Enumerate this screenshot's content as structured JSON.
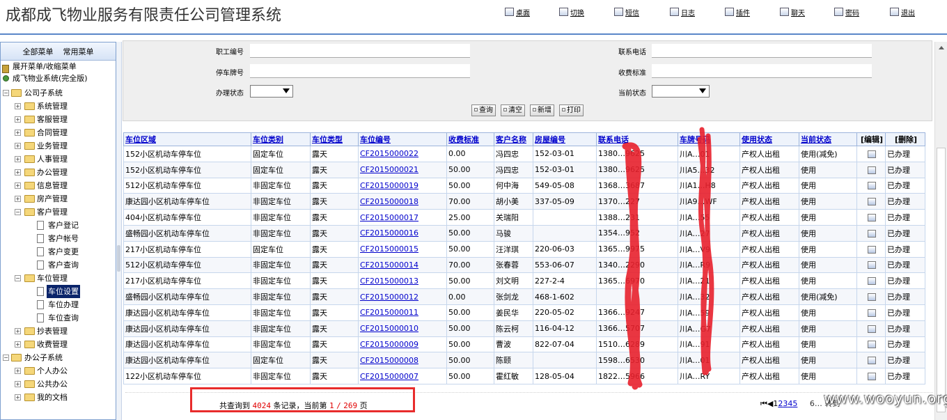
{
  "app": {
    "title": "成都成飞物业服务有限责任公司管理系统"
  },
  "toolbar": {
    "items": [
      {
        "label": "桌面",
        "icon": "desktop-icon"
      },
      {
        "label": "切换",
        "icon": "switch-icon"
      },
      {
        "label": "短信",
        "icon": "sms-icon"
      },
      {
        "label": "日志",
        "icon": "log-icon"
      },
      {
        "label": "插件",
        "icon": "plugin-icon"
      },
      {
        "label": "聊天",
        "icon": "chat-icon"
      },
      {
        "label": "密码",
        "icon": "password-icon"
      },
      {
        "label": "退出",
        "icon": "logout-icon"
      }
    ]
  },
  "sidebar": {
    "tabs": [
      "全部菜单",
      "常用菜单"
    ],
    "expand_label": "展开菜单/收缩菜单",
    "root_label": "成飞物业系统(完全版)",
    "company": "公司子系统",
    "modules": [
      "系统管理",
      "客服管理",
      "合同管理",
      "业务管理",
      "人事管理",
      "办公管理",
      "信息管理",
      "房产管理"
    ],
    "customer": {
      "label": "客户管理",
      "children": [
        "客户登记",
        "客户帐号",
        "客户变更",
        "客户查询"
      ]
    },
    "parking": {
      "label": "车位管理",
      "children": [
        "车位设置",
        "车位办理",
        "车位查询"
      ]
    },
    "after": [
      "抄表管理",
      "收费管理"
    ],
    "office": {
      "label": "办公子系统",
      "children": [
        "个人办公",
        "公共办公",
        "我的文档"
      ]
    }
  },
  "search": {
    "labels": {
      "employee_no": "职工编号",
      "phone": "联系电话",
      "plate": "停车牌号",
      "fee": "收费标准",
      "status": "办理状态",
      "current_status": "当前状态"
    },
    "values": {
      "employee_no": "",
      "phone": "",
      "plate": "",
      "fee": ""
    },
    "buttons": [
      "查询",
      "清空",
      "新增",
      "打印"
    ]
  },
  "table": {
    "headers": [
      "车位区域",
      "车位类别",
      "车位类型",
      "车位编号",
      "收费标准",
      "客户名称",
      "房屋编号",
      "联系电话",
      "车牌号码",
      "使用状态",
      "当前状态",
      "[编辑]",
      "[删除]"
    ],
    "rows": [
      [
        "152小区机动车停车位",
        "固定车位",
        "露天",
        "CF2015000022",
        "0.00",
        "冯四忠",
        "152-03-01",
        "1380…9625",
        "川A…01",
        "产权人出租",
        "使用(减免)",
        "已办理"
      ],
      [
        "152小区机动车停车位",
        "固定车位",
        "露天",
        "CF2015000021",
        "50.00",
        "冯四忠",
        "152-03-01",
        "1380…9625",
        "川A5…32",
        "产权人出租",
        "使用",
        "已办理"
      ],
      [
        "512小区机动车停车位",
        "非固定车位",
        "露天",
        "CF2015000019",
        "50.00",
        "何中海",
        "549-05-08",
        "1368…3687",
        "川A1…H8",
        "产权人出租",
        "使用",
        "已办理"
      ],
      [
        "康达园小区机动车停车位",
        "非固定车位",
        "露天",
        "CF2015000018",
        "70.00",
        "胡小美",
        "337-05-09",
        "1370…227",
        "川A9…WF",
        "产权人出租",
        "使用",
        "已办理"
      ],
      [
        "404小区机动车停车位",
        "非固定车位",
        "露天",
        "CF2015000017",
        "25.00",
        "关瑞阳",
        "",
        "1388…231",
        "川A…55",
        "产权人出租",
        "使用",
        "已办理"
      ],
      [
        "盛畅园小区机动车停车位",
        "非固定车位",
        "露天",
        "CF2015000016",
        "50.00",
        "马骏",
        "",
        "1354…952",
        "川A…27",
        "产权人出租",
        "使用",
        "已办理"
      ],
      [
        "217小区机动车停车位",
        "固定车位",
        "露天",
        "CF2015000015",
        "50.00",
        "汪洋琪",
        "220-06-03",
        "1365…9975",
        "川A…V9",
        "产权人出租",
        "使用",
        "已办理"
      ],
      [
        "512小区机动车停车位",
        "非固定车位",
        "露天",
        "CF2015000014",
        "70.00",
        "张春蓉",
        "553-06-07",
        "1340…2290",
        "川A…R9",
        "产权人出租",
        "使用",
        "已办理"
      ],
      [
        "217小区机动车停车位",
        "非固定车位",
        "露天",
        "CF2015000013",
        "50.00",
        "刘文明",
        "227-2-4",
        "1365…6970",
        "川A…21",
        "产权人出租",
        "使用",
        "已办理"
      ],
      [
        "盛畅园小区机动车停车位",
        "非固定车位",
        "露天",
        "CF2015000012",
        "0.00",
        "张剑龙",
        "468-1-602",
        "",
        "川A…32",
        "产权人出租",
        "使用(减免)",
        "已办理"
      ],
      [
        "康达园小区机动车停车位",
        "非固定车位",
        "露天",
        "CF2015000011",
        "50.00",
        "姜民华",
        "220-05-02",
        "1366…9247",
        "川A…59",
        "产权人出租",
        "使用",
        "已办理"
      ],
      [
        "康达园小区机动车停车位",
        "非固定车位",
        "露天",
        "CF2015000010",
        "50.00",
        "陈云柯",
        "116-04-12",
        "1366…5707",
        "川A…G7",
        "产权人出租",
        "使用",
        "已办理"
      ],
      [
        "康达园小区机动车停车位",
        "非固定车位",
        "露天",
        "CF2015000009",
        "50.00",
        "曹波",
        "822-07-04",
        "1510…6289",
        "川A…91",
        "产权人出租",
        "使用",
        "已办理"
      ],
      [
        "康达园小区机动车停车位",
        "固定车位",
        "露天",
        "CF2015000008",
        "50.00",
        "陈颐",
        "",
        "1598…6530",
        "川A…01",
        "产权人出租",
        "使用",
        "已办理"
      ],
      [
        "122小区机动车停车位",
        "非固定车位",
        "露天",
        "CF2015000007",
        "50.00",
        "霍红敏",
        "128-05-04",
        "1822…5966",
        "川A…RY",
        "产权人出租",
        "使用",
        "已办理"
      ]
    ]
  },
  "pager": {
    "prefix": "共查询到",
    "total": "4024",
    "mid": "条记录，当前第",
    "current": "1",
    "sep": "/",
    "pages": "269",
    "suffix": "页",
    "nav_prefix": "⏮◀",
    "current_page_number": "1",
    "page_links": [
      "2",
      "3",
      "4",
      "5"
    ],
    "nav_more": "6…  转到"
  },
  "watermark": "www.wooyun.org",
  "colors": {
    "header_line": "#5a86c8",
    "link": "#0000cc",
    "highlight": "#e82c2c",
    "scribble": "#e8202c"
  }
}
